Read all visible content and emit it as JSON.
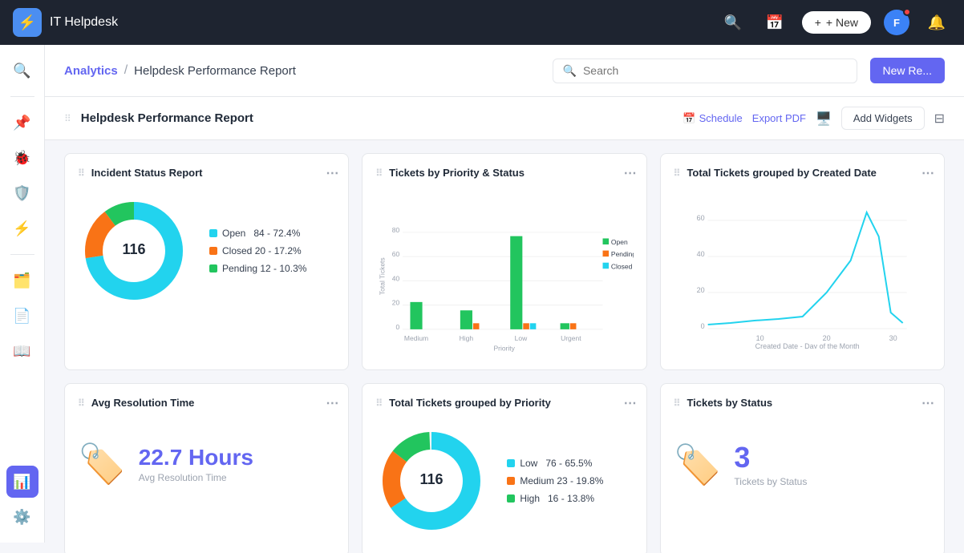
{
  "topnav": {
    "logo_label": "IT Helpdesk",
    "new_button": "+ New",
    "search_icon": "🔍",
    "calendar_icon": "📅"
  },
  "breadcrumb": {
    "analytics": "Analytics",
    "separator": "/",
    "current": "Helpdesk Performance Report"
  },
  "search": {
    "placeholder": "Search"
  },
  "new_report_btn": "New Re...",
  "report": {
    "title": "Helpdesk Performance Report",
    "schedule_btn": "Schedule",
    "export_btn": "Export PDF",
    "add_widgets_btn": "Add Widgets"
  },
  "widgets": {
    "incident_status": {
      "title": "Incident Status Report",
      "total": "116",
      "segments": [
        {
          "label": "Open",
          "value": 84,
          "percent": "72.4%",
          "color": "#22d3ee"
        },
        {
          "label": "Closed",
          "value": 20,
          "percent": "17.2%",
          "color": "#f97316"
        },
        {
          "label": "Pending",
          "value": 12,
          "percent": "10.3%",
          "color": "#22c55e"
        }
      ]
    },
    "tickets_priority_status": {
      "title": "Tickets by Priority & Status",
      "y_label": "Total Tickets",
      "x_label": "Priority",
      "x_ticks": [
        "Medium",
        "High",
        "Low",
        "Urgent"
      ],
      "y_ticks": [
        0,
        20,
        40,
        60,
        80
      ],
      "legend": [
        "Open",
        "Pending",
        "Closed"
      ],
      "legend_colors": [
        "#22c55e",
        "#f97316",
        "#22d3ee"
      ],
      "bars": {
        "Medium": {
          "Open": 22,
          "Pending": 0,
          "Closed": 0
        },
        "High": {
          "Open": 15,
          "Pending": 5,
          "Closed": 0
        },
        "Low": {
          "Open": 75,
          "Pending": 5,
          "Closed": 5
        },
        "Urgent": {
          "Open": 5,
          "Pending": 3,
          "Closed": 2
        }
      }
    },
    "tickets_created_date": {
      "title": "Total Tickets grouped by Created Date",
      "x_label": "Created Date - Day of the Month",
      "x_ticks": [
        10,
        20,
        30
      ],
      "y_ticks": [
        0,
        20,
        40,
        60
      ],
      "color": "#22d3ee"
    },
    "avg_resolution": {
      "title": "Avg Resolution Time",
      "value": "22.7 Hours",
      "label": "Avg Resolution Time"
    },
    "tickets_by_priority": {
      "title": "Total Tickets grouped by Priority",
      "total": "116",
      "segments": [
        {
          "label": "Low",
          "value": 76,
          "percent": "65.5%",
          "color": "#22d3ee"
        },
        {
          "label": "Medium",
          "value": 23,
          "percent": "19.8%",
          "color": "#f97316"
        },
        {
          "label": "High",
          "value": 16,
          "percent": "13.8%",
          "color": "#22c55e"
        }
      ]
    },
    "tickets_by_status": {
      "title": "Tickets by Status",
      "value": "3"
    }
  }
}
